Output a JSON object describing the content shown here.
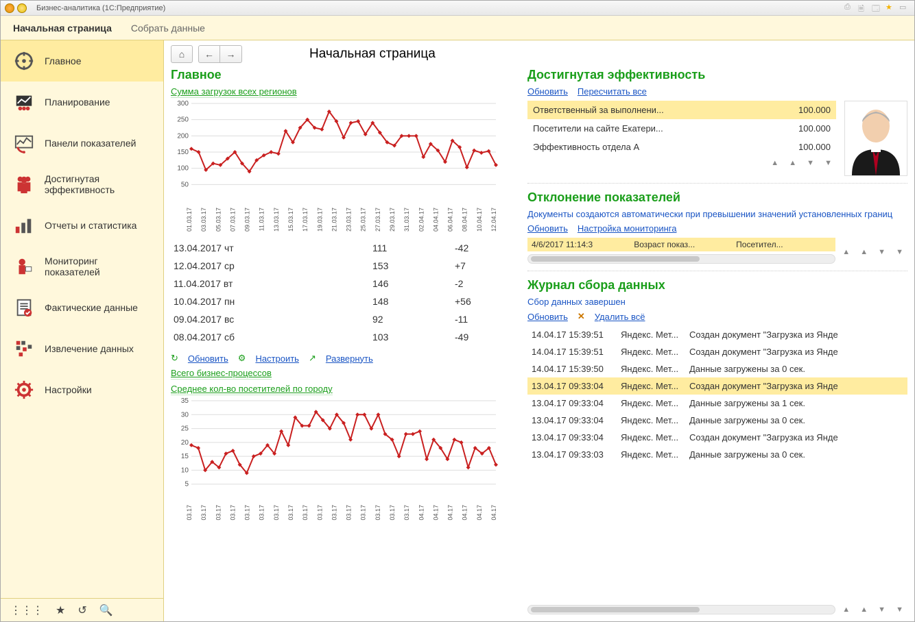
{
  "window_title": "Бизнес-аналитика  (1C:Предприятие)",
  "tabs": {
    "active": "Начальная страница",
    "inactive": "Собрать данные"
  },
  "sidebar": {
    "items": [
      {
        "label": "Главное"
      },
      {
        "label": "Планирование"
      },
      {
        "label": "Панели показателей"
      },
      {
        "label": "Достигнутая\nэффективность"
      },
      {
        "label": "Отчеты и статистика"
      },
      {
        "label": "Мониторинг показателей"
      },
      {
        "label": "Фактические данные"
      },
      {
        "label": "Извлечение данных"
      },
      {
        "label": "Настройки"
      }
    ]
  },
  "page_title": "Начальная страница",
  "mainL": {
    "heading": "Главное",
    "chart1_link": "Сумма загрузок всех регионов",
    "table": [
      {
        "d": "13.04.2017 чт",
        "v": "111",
        "dlt": "-42"
      },
      {
        "d": "12.04.2017 ср",
        "v": "153",
        "dlt": "+7"
      },
      {
        "d": "11.04.2017 вт",
        "v": "146",
        "dlt": "-2"
      },
      {
        "d": "10.04.2017 пн",
        "v": "148",
        "dlt": "+56"
      },
      {
        "d": "09.04.2017 вс",
        "v": "92",
        "dlt": "-11"
      },
      {
        "d": "08.04.2017 сб",
        "v": "103",
        "dlt": "-49"
      }
    ],
    "actions": {
      "refresh": "Обновить",
      "setup": "Настроить",
      "expand": "Развернуть"
    },
    "link2": "Всего бизнес-процессов",
    "link3": "Среднее кол-во посетителей по городу"
  },
  "eff": {
    "heading": "Достигнутая эффективность",
    "links": {
      "refresh": "Обновить",
      "recalc": "Пересчитать все"
    },
    "rows": [
      {
        "name": "Ответственный за выполнени...",
        "val": "100.000"
      },
      {
        "name": "Посетители на сайте Екатери...",
        "val": "100.000"
      },
      {
        "name": "Эффективность отдела А",
        "val": "100.000"
      }
    ]
  },
  "dev": {
    "heading": "Отклонение показателей",
    "hint": "Документы создаются автоматически при превышении значений установленных границ",
    "links": {
      "refresh": "Обновить",
      "setup": "Настройка мониторинга"
    },
    "row": {
      "c1": "4/6/2017 11:14:3",
      "c2": "Возраст показ...",
      "c3": "Посетител..."
    }
  },
  "log": {
    "heading": "Журнал сбора данных",
    "sub": "Сбор данных завершен",
    "links": {
      "refresh": "Обновить",
      "delall": "Удалить всё"
    },
    "rows": [
      {
        "t": "14.04.17 15:39:51",
        "s": "Яндекс. Мет...",
        "m": "Создан документ \"Загрузка из Янде",
        "sel": false
      },
      {
        "t": "14.04.17 15:39:51",
        "s": "Яндекс. Мет...",
        "m": "Создан документ \"Загрузка из Янде",
        "sel": false
      },
      {
        "t": "14.04.17 15:39:50",
        "s": "Яндекс. Мет...",
        "m": "Данные загружены за 0 сек.",
        "sel": false
      },
      {
        "t": "13.04.17 09:33:04",
        "s": "Яндекс. Мет...",
        "m": "Создан документ \"Загрузка из Янде",
        "sel": true
      },
      {
        "t": "13.04.17 09:33:04",
        "s": "Яндекс. Мет...",
        "m": "Данные загружены за 1 сек.",
        "sel": false
      },
      {
        "t": "13.04.17 09:33:04",
        "s": "Яндекс. Мет...",
        "m": "Данные загружены за 0 сек.",
        "sel": false
      },
      {
        "t": "13.04.17 09:33:04",
        "s": "Яндекс. Мет...",
        "m": "Создан документ \"Загрузка из Янде",
        "sel": false
      },
      {
        "t": "13.04.17 09:33:03",
        "s": "Яндекс. Мет...",
        "m": "Данные загружены за 0 сек.",
        "sel": false
      }
    ]
  },
  "chart_data": [
    {
      "type": "line",
      "title": "Сумма загрузок всех регионов",
      "xlabel": "",
      "ylabel": "",
      "ylim": [
        0,
        300
      ],
      "yticks": [
        50,
        100,
        150,
        200,
        250,
        300
      ],
      "categories": [
        "01.03.17",
        "03.03.17",
        "05.03.17",
        "07.03.17",
        "09.03.17",
        "11.03.17",
        "13.03.17",
        "15.03.17",
        "17.03.17",
        "19.03.17",
        "21.03.17",
        "23.03.17",
        "25.03.17",
        "27.03.17",
        "29.03.17",
        "31.03.17",
        "02.04.17",
        "04.04.17",
        "06.04.17",
        "08.04.17",
        "10.04.17",
        "12.04.17"
      ],
      "values": [
        160,
        150,
        95,
        115,
        110,
        130,
        150,
        115,
        90,
        125,
        140,
        150,
        145,
        215,
        180,
        225,
        250,
        225,
        220,
        275,
        245,
        195,
        240,
        245,
        205,
        240,
        210,
        180,
        170,
        200,
        200,
        200,
        135,
        175,
        155,
        120,
        185,
        165,
        103,
        155,
        148,
        153,
        110
      ]
    },
    {
      "type": "line",
      "title": "Среднее кол-во посетителей по городу",
      "xlabel": "",
      "ylabel": "",
      "ylim": [
        0,
        35
      ],
      "yticks": [
        5,
        10,
        15,
        20,
        25,
        30,
        35
      ],
      "categories": [
        "03.17",
        "03.17",
        "03.17",
        "03.17",
        "03.17",
        "03.17",
        "03.17",
        "03.17",
        "03.17",
        "03.17",
        "03.17",
        "03.17",
        "03.17",
        "03.17",
        "03.17",
        "03.17",
        "04.17",
        "04.17",
        "04.17",
        "04.17",
        "04.17",
        "04.17"
      ],
      "values": [
        19,
        18,
        10,
        13,
        11,
        16,
        17,
        12,
        9,
        15,
        16,
        19,
        16,
        24,
        19,
        29,
        26,
        26,
        31,
        28,
        25,
        30,
        27,
        21,
        30,
        30,
        25,
        30,
        23,
        21,
        15,
        23,
        23,
        24,
        14,
        21,
        18,
        14,
        21,
        20,
        11,
        18,
        16,
        18,
        12
      ]
    }
  ],
  "nav_arrows": "▲  ▲  ▼  ▼"
}
